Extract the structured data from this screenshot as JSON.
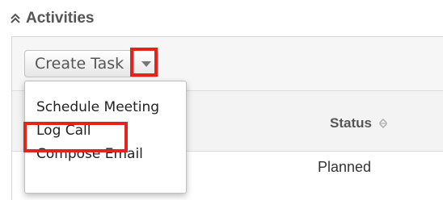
{
  "panel": {
    "title": "Activities",
    "collapse_icon": "double-chevron-up-icon"
  },
  "toolbar": {
    "create_task_label": "Create Task",
    "caret_icon": "caret-down-icon"
  },
  "dropdown": {
    "items": [
      {
        "label": "Schedule Meeting"
      },
      {
        "label": "Log Call"
      },
      {
        "label": "Compose Email"
      }
    ]
  },
  "table": {
    "columns": [
      {
        "label": "Status",
        "sort_icon": "sort-icon"
      }
    ],
    "rows": [
      {
        "status": "Planned"
      }
    ]
  },
  "colors": {
    "highlight": "#e3241b",
    "header_bg": "#f3f3f3",
    "toolbar_bg": "#f6f6f6"
  }
}
